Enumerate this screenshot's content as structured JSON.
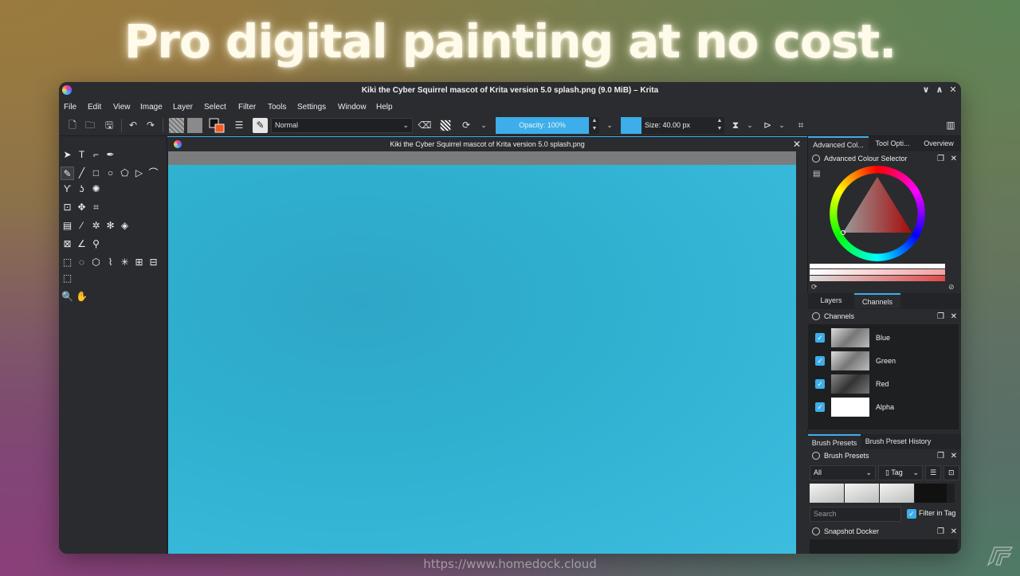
{
  "headline": "Pro digital painting at no cost.",
  "footer_url": "https://www.homedock.cloud",
  "window": {
    "title": "Kiki the Cyber Squirrel mascot of Krita version 5.0 splash.png (9.0 MiB) – Krita",
    "controls": {
      "minimize": "∨",
      "maximize": "∧",
      "close": "✕"
    }
  },
  "menu": [
    "File",
    "Edit",
    "View",
    "Image",
    "Layer",
    "Select",
    "Filter",
    "Tools",
    "Settings",
    "Window",
    "Help"
  ],
  "toolbar": {
    "blend_mode": "Normal",
    "opacity": "Opacity: 100%",
    "size": "Size: 40.00 px",
    "accent": "#3daee9"
  },
  "document": {
    "tab_title": "Kiki the Cyber Squirrel mascot of Krita version 5.0 splash.png",
    "close": "✕",
    "canvas_color": "#2fb0cf"
  },
  "dockers": {
    "top_tabs": [
      "Advanced Col...",
      "Tool Opti...",
      "Overview"
    ],
    "advanced_colour_selector": "Advanced Colour Selector",
    "layer_tabs": [
      "Layers",
      "Channels"
    ],
    "channels_title": "Channels",
    "channels": [
      {
        "name": "Blue",
        "checked": true
      },
      {
        "name": "Green",
        "checked": true
      },
      {
        "name": "Red",
        "checked": true
      },
      {
        "name": "Alpha",
        "checked": true
      }
    ],
    "brush_tabs": [
      "Brush Presets",
      "Brush Preset History"
    ],
    "brush_presets_title": "Brush Presets",
    "brush_filter": "All",
    "brush_tag": "Tag",
    "search_placeholder": "Search",
    "filter_in_tag": "Filter in Tag",
    "snapshot_docker": "Snapshot Docker"
  }
}
